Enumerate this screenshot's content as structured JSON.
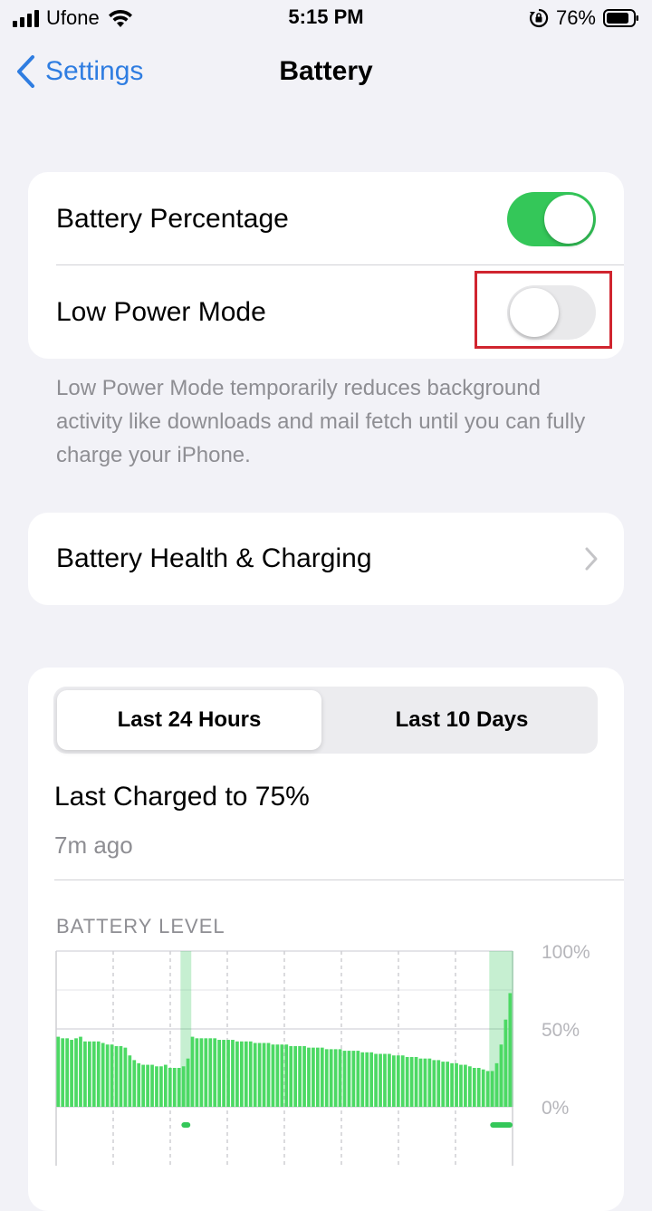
{
  "status_bar": {
    "carrier": "Ufone",
    "time": "5:15 PM",
    "battery_percent": "76%"
  },
  "nav": {
    "back_label": "Settings",
    "title": "Battery"
  },
  "settings": {
    "battery_percentage": {
      "label": "Battery Percentage",
      "on": true
    },
    "low_power_mode": {
      "label": "Low Power Mode",
      "on": false
    },
    "footnote": "Low Power Mode temporarily reduces background activity like downloads and mail fetch until you can fully charge your iPhone."
  },
  "health": {
    "label": "Battery Health & Charging"
  },
  "usage": {
    "tabs": [
      {
        "label": "Last 24 Hours",
        "selected": true
      },
      {
        "label": "Last 10 Days",
        "selected": false
      }
    ],
    "last_charged": "Last Charged to 75%",
    "last_charged_ago": "7m ago",
    "chart_title": "BATTERY LEVEL"
  },
  "colors": {
    "accent": "#007aff",
    "toggle_on": "#34c759",
    "bar": "#4cd964",
    "highlight_box": "#d0252f"
  },
  "chart_data": {
    "type": "bar",
    "ylabel_ticks": [
      "100%",
      "50%",
      "0%"
    ],
    "ylim": [
      0,
      100
    ],
    "values": [
      45,
      44,
      44,
      43,
      44,
      45,
      42,
      42,
      42,
      42,
      41,
      40,
      40,
      39,
      39,
      38,
      33,
      30,
      28,
      27,
      27,
      27,
      26,
      26,
      27,
      25,
      25,
      25,
      26,
      31,
      45,
      44,
      44,
      44,
      44,
      44,
      43,
      43,
      43,
      43,
      42,
      42,
      42,
      42,
      41,
      41,
      41,
      41,
      40,
      40,
      40,
      40,
      39,
      39,
      39,
      39,
      38,
      38,
      38,
      38,
      37,
      37,
      37,
      37,
      36,
      36,
      36,
      36,
      35,
      35,
      35,
      34,
      34,
      34,
      34,
      33,
      33,
      33,
      32,
      32,
      32,
      31,
      31,
      31,
      30,
      30,
      29,
      29,
      28,
      28,
      27,
      27,
      26,
      25,
      25,
      24,
      23,
      23,
      28,
      40,
      56,
      73
    ],
    "charging_bands": [
      {
        "start_index": 28,
        "end_index": 29
      },
      {
        "start_index": 97,
        "end_index": 101
      }
    ]
  }
}
